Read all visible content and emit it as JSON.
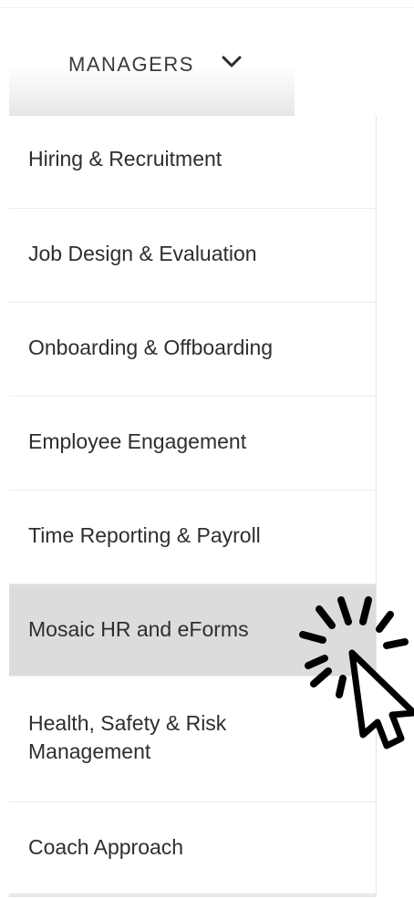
{
  "nav": {
    "trigger_label": "MANAGERS",
    "chevron_icon": "chevron-down-icon"
  },
  "menu": {
    "items": [
      {
        "label": "Hiring & Recruitment",
        "active": false
      },
      {
        "label": "Job Design & Evaluation",
        "active": false
      },
      {
        "label": "Onboarding & Offboarding",
        "active": false
      },
      {
        "label": "Employee Engagement",
        "active": false
      },
      {
        "label": "Time Reporting & Payroll",
        "active": false
      },
      {
        "label": "Mosaic HR and eForms",
        "active": true
      },
      {
        "label": "Health, Safety & Risk Management",
        "active": false
      },
      {
        "label": "Coach Approach",
        "active": false
      }
    ]
  },
  "cursor": {
    "icon": "pointer-cursor-icon",
    "effect_icon": "click-burst-icon"
  },
  "colors": {
    "active_bg": "#dcdcdc",
    "text": "#2e2e2e",
    "divider": "#ececec"
  }
}
